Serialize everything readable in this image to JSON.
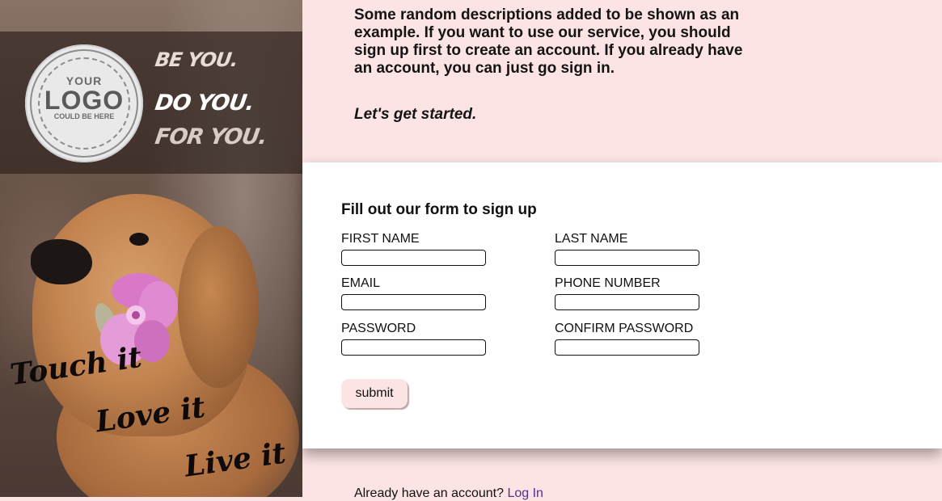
{
  "logo": {
    "top": "YOUR",
    "main": "LOGO",
    "bottom": "COULD BE HERE"
  },
  "slogans": [
    "BE YOU.",
    "DO YOU.",
    "FOR YOU."
  ],
  "script_words": [
    "Touch it",
    "Love it",
    "Live it"
  ],
  "intro": {
    "description": "Some random descriptions added to be shown as an example. If you want to use our service, you should sign up first to create an account. If you already have an account, you can just go sign in.",
    "cta": "Let's get started."
  },
  "form": {
    "title": "Fill out our form to sign up",
    "fields": {
      "first_name": "FIRST NAME",
      "last_name": "LAST NAME",
      "email": "EMAIL",
      "phone": "PHONE NUMBER",
      "password": "PASSWORD",
      "confirm_password": "CONFIRM PASSWORD"
    },
    "submit_label": "submit"
  },
  "footer": {
    "text": "Already have an account?",
    "link_label": "Log In"
  },
  "colors": {
    "background": "#fce4e4",
    "card": "#ffffff",
    "link": "#5a2d91"
  }
}
